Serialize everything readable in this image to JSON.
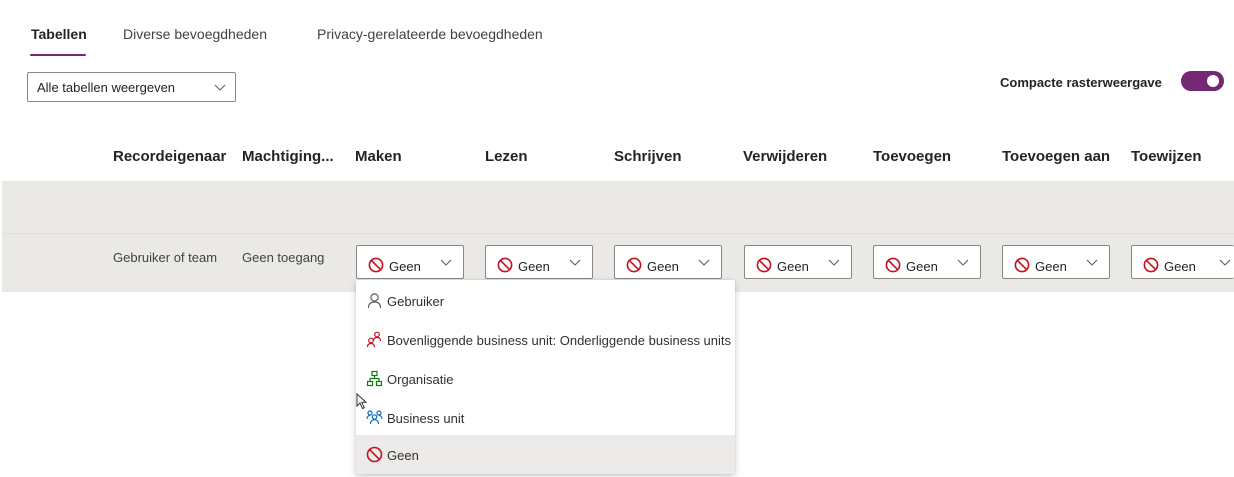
{
  "tabs": [
    {
      "label": "Tabellen",
      "active": true
    },
    {
      "label": "Diverse bevoegdheden",
      "active": false
    },
    {
      "label": "Privacy-gerelateerde bevoegdheden",
      "active": false
    }
  ],
  "filter": {
    "value": "Alle tabellen weergeven"
  },
  "compact_view": {
    "label": "Compacte rasterweergave",
    "on": true
  },
  "columns": [
    "Recordeigenaar",
    "Machtiging...",
    "Maken",
    "Lezen",
    "Schrijven",
    "Verwijderen",
    "Toevoegen",
    "Toevoegen aan",
    "Toewijzen"
  ],
  "row": {
    "owner": "Gebruiker of team",
    "permission": "Geen toegang",
    "cells": [
      "Geen",
      "Geen",
      "Geen",
      "Geen",
      "Geen",
      "Geen",
      "Geen"
    ]
  },
  "dropdown_menu": {
    "items": [
      {
        "label": "Gebruiker",
        "icon": "user-icon"
      },
      {
        "label": "Bovenliggende business unit: Onderliggende business units",
        "icon": "parent-child-business-unit-icon"
      },
      {
        "label": "Organisatie",
        "icon": "organization-icon"
      },
      {
        "label": "Business unit",
        "icon": "business-unit-icon"
      },
      {
        "label": "Geen",
        "icon": "no-access-icon",
        "selected": true
      }
    ]
  },
  "colors": {
    "accent": "#742774",
    "band": "#ebe9e6",
    "no_access_red": "#c50f1f",
    "org_green": "#107c10",
    "bu_blue": "#0f6cbd"
  }
}
